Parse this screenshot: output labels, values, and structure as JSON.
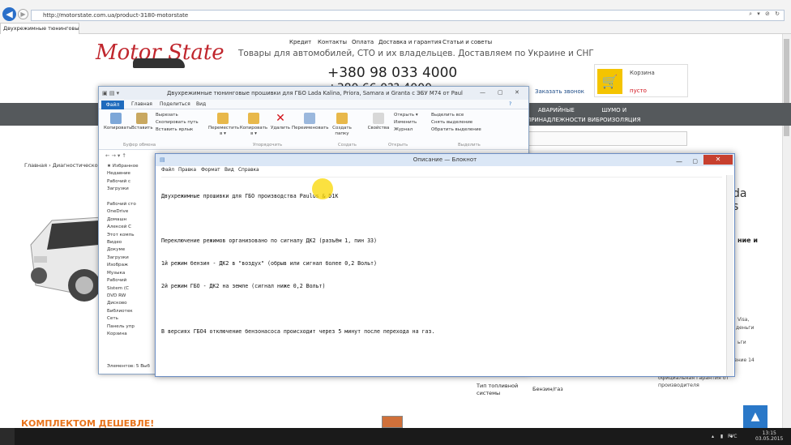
{
  "browser": {
    "url": "http://motorstate.com.ua/product-3180-motorstate",
    "tab_title": "Двухрежимные тюнинговые...",
    "address_tools": "⌕ ▾ ⊘ ↻"
  },
  "site": {
    "logo_text": "Motor State",
    "top_nav": [
      "Кредит",
      "Контакты",
      "Оплата",
      "Доставка и гарантия",
      "Статьи и советы"
    ],
    "tagline": "Товары для автомобилей, СТО и их владельцев. Доставляем по Украине и СНГ",
    "phone1": "+380 98 033 4000",
    "phone2": "+380 66 0?? 4000",
    "cart_title": "Корзина",
    "cart_status": "пусто",
    "callback": "Заказать звонок",
    "menu": [
      "АВАРИЙНЫЕ\nПРИНАДЛЕЖНОСТИ",
      "ШУМО И\nВИБРОИЗОЛЯЦИЯ"
    ],
    "breadcrumb": "Главная  ›  Диагностическое о",
    "right_a": "da",
    "right_b": "s",
    "right_c": "ние и",
    "right_small": [
      "Visa,",
      "деньги",
      "ьги",
      "ение 14"
    ],
    "spec_label": "Тип топливной\nсистемы",
    "spec_value": "Бензин/газ",
    "guarantee": "официальная гарантия от\nпроизводителя",
    "promo": "КОМПЛЕКТОМ ДЕШЕВЛЕ!",
    "scroll_top": "▲"
  },
  "explorer": {
    "title": "Двухрежимные тюнинговые прошивки для ГБО Lada Kalina, Priora, Samara и Granta с ЭБУ М74 от Paul",
    "tabs": [
      "Файл",
      "Главная",
      "Поделиться",
      "Вид"
    ],
    "ribbon": {
      "copy": "Копировать",
      "paste": "Вставить",
      "cut": "Вырезать",
      "copy_path": "Скопировать путь",
      "paste_shortcut": "Вставить ярлык",
      "move": "Переместить в ▾",
      "copy_to": "Копировать в ▾",
      "delete": "Удалить",
      "rename": "Переименовать",
      "new_folder": "Создать папку",
      "properties": "Свойства",
      "open": "Открыть ▾",
      "edit": "Изменить",
      "history": "Журнал",
      "select_all": "Выделить все",
      "select_none": "Снять выделение",
      "invert": "Обратить выделение"
    },
    "groups": [
      "Буфер обмена",
      "Упорядочить",
      "Создать",
      "Открыть",
      "Выделить"
    ],
    "nav": "←  →  ▾  ↑",
    "tree": [
      "★ Избранное",
      "  Недавние",
      "  Рабочий с",
      "  Загрузки",
      "",
      "Рабочий сто",
      "  OneDrive",
      "  Домашн",
      "  Алексей С",
      "  Этот компь",
      "    Видео",
      "    Докуме",
      "    Загрузки",
      "    Изображ",
      "    Музыка",
      "    Рабочий",
      "    Sistem (C",
      "    DVD RW",
      "    Дисково",
      "  Библиотек",
      "  Сеть",
      "  Панель упр",
      "  Корзина"
    ],
    "status": "Элементов: 5   Выб"
  },
  "notepad": {
    "title": "Описание — Блокнот",
    "menu": [
      "Файл",
      "Правка",
      "Формат",
      "Вид",
      "Справка"
    ],
    "lines": [
      "Двухрежимные прошивки для ГБО производства Paulus & D1K",
      "",
      "Переключение режимов организовано по сигналу ДК2 (разъём 1, пин 33)",
      "1й режим бензин - ДК2 в \"воздух\" (обрыв или сигнал более 0,2 Вольт)",
      "2й режим ГБО - ДК2 на земле (сигнал ниже 0,2 Вольт)",
      "",
      "В версиях ГБО4 отключение бензонасоса происходит через 5 минут после перехода на газ."
    ]
  },
  "taskbar": {
    "lang": "РУС",
    "time": "13:15",
    "date": "03.05.2015",
    "tray_icons": "▴ ▮ ◂"
  }
}
